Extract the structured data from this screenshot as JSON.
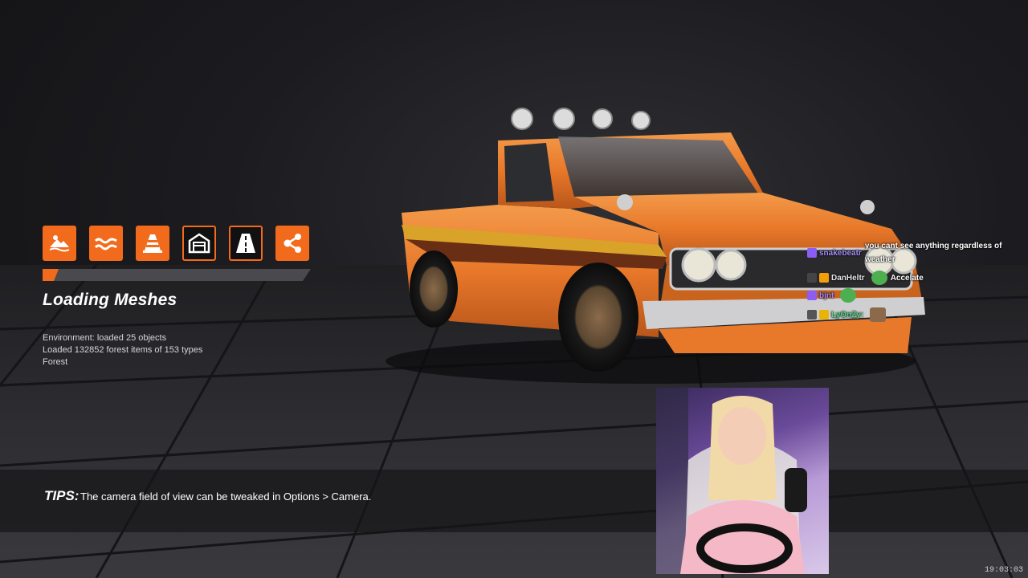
{
  "loading": {
    "progress": 0.06,
    "title": "Loading Meshes",
    "status_lines": [
      "Environment: loaded 25 objects",
      "Loaded 132852 forest items of 153 types",
      "Forest"
    ],
    "mode_icons": [
      {
        "name": "hill-climb-icon",
        "style": "filled"
      },
      {
        "name": "water-waves-icon",
        "style": "filled"
      },
      {
        "name": "traffic-cone-icon",
        "style": "filled"
      },
      {
        "name": "garage-icon",
        "style": "outlined"
      },
      {
        "name": "road-icon",
        "style": "outlined"
      },
      {
        "name": "share-nodes-icon",
        "style": "filled"
      }
    ]
  },
  "tips": {
    "label": "TIPS:",
    "text": "The camera field of view can be tweaked in Options > Camera."
  },
  "chat": [
    {
      "user": "snakebeatr",
      "message": "you cant see anything regardless of weather",
      "user_color": "#a78bfa"
    },
    {
      "user": "DanHeltr",
      "message": "Accelate",
      "user_color": "#e5e5e5"
    },
    {
      "user": "bjnt",
      "message": "",
      "user_color": "#a78bfa"
    },
    {
      "user": "LyOnZy:",
      "message": "",
      "user_color": "#4ade80"
    }
  ],
  "clock": "19:03:03",
  "colors": {
    "accent": "#f26a1b",
    "car_body": "#e8782a"
  }
}
